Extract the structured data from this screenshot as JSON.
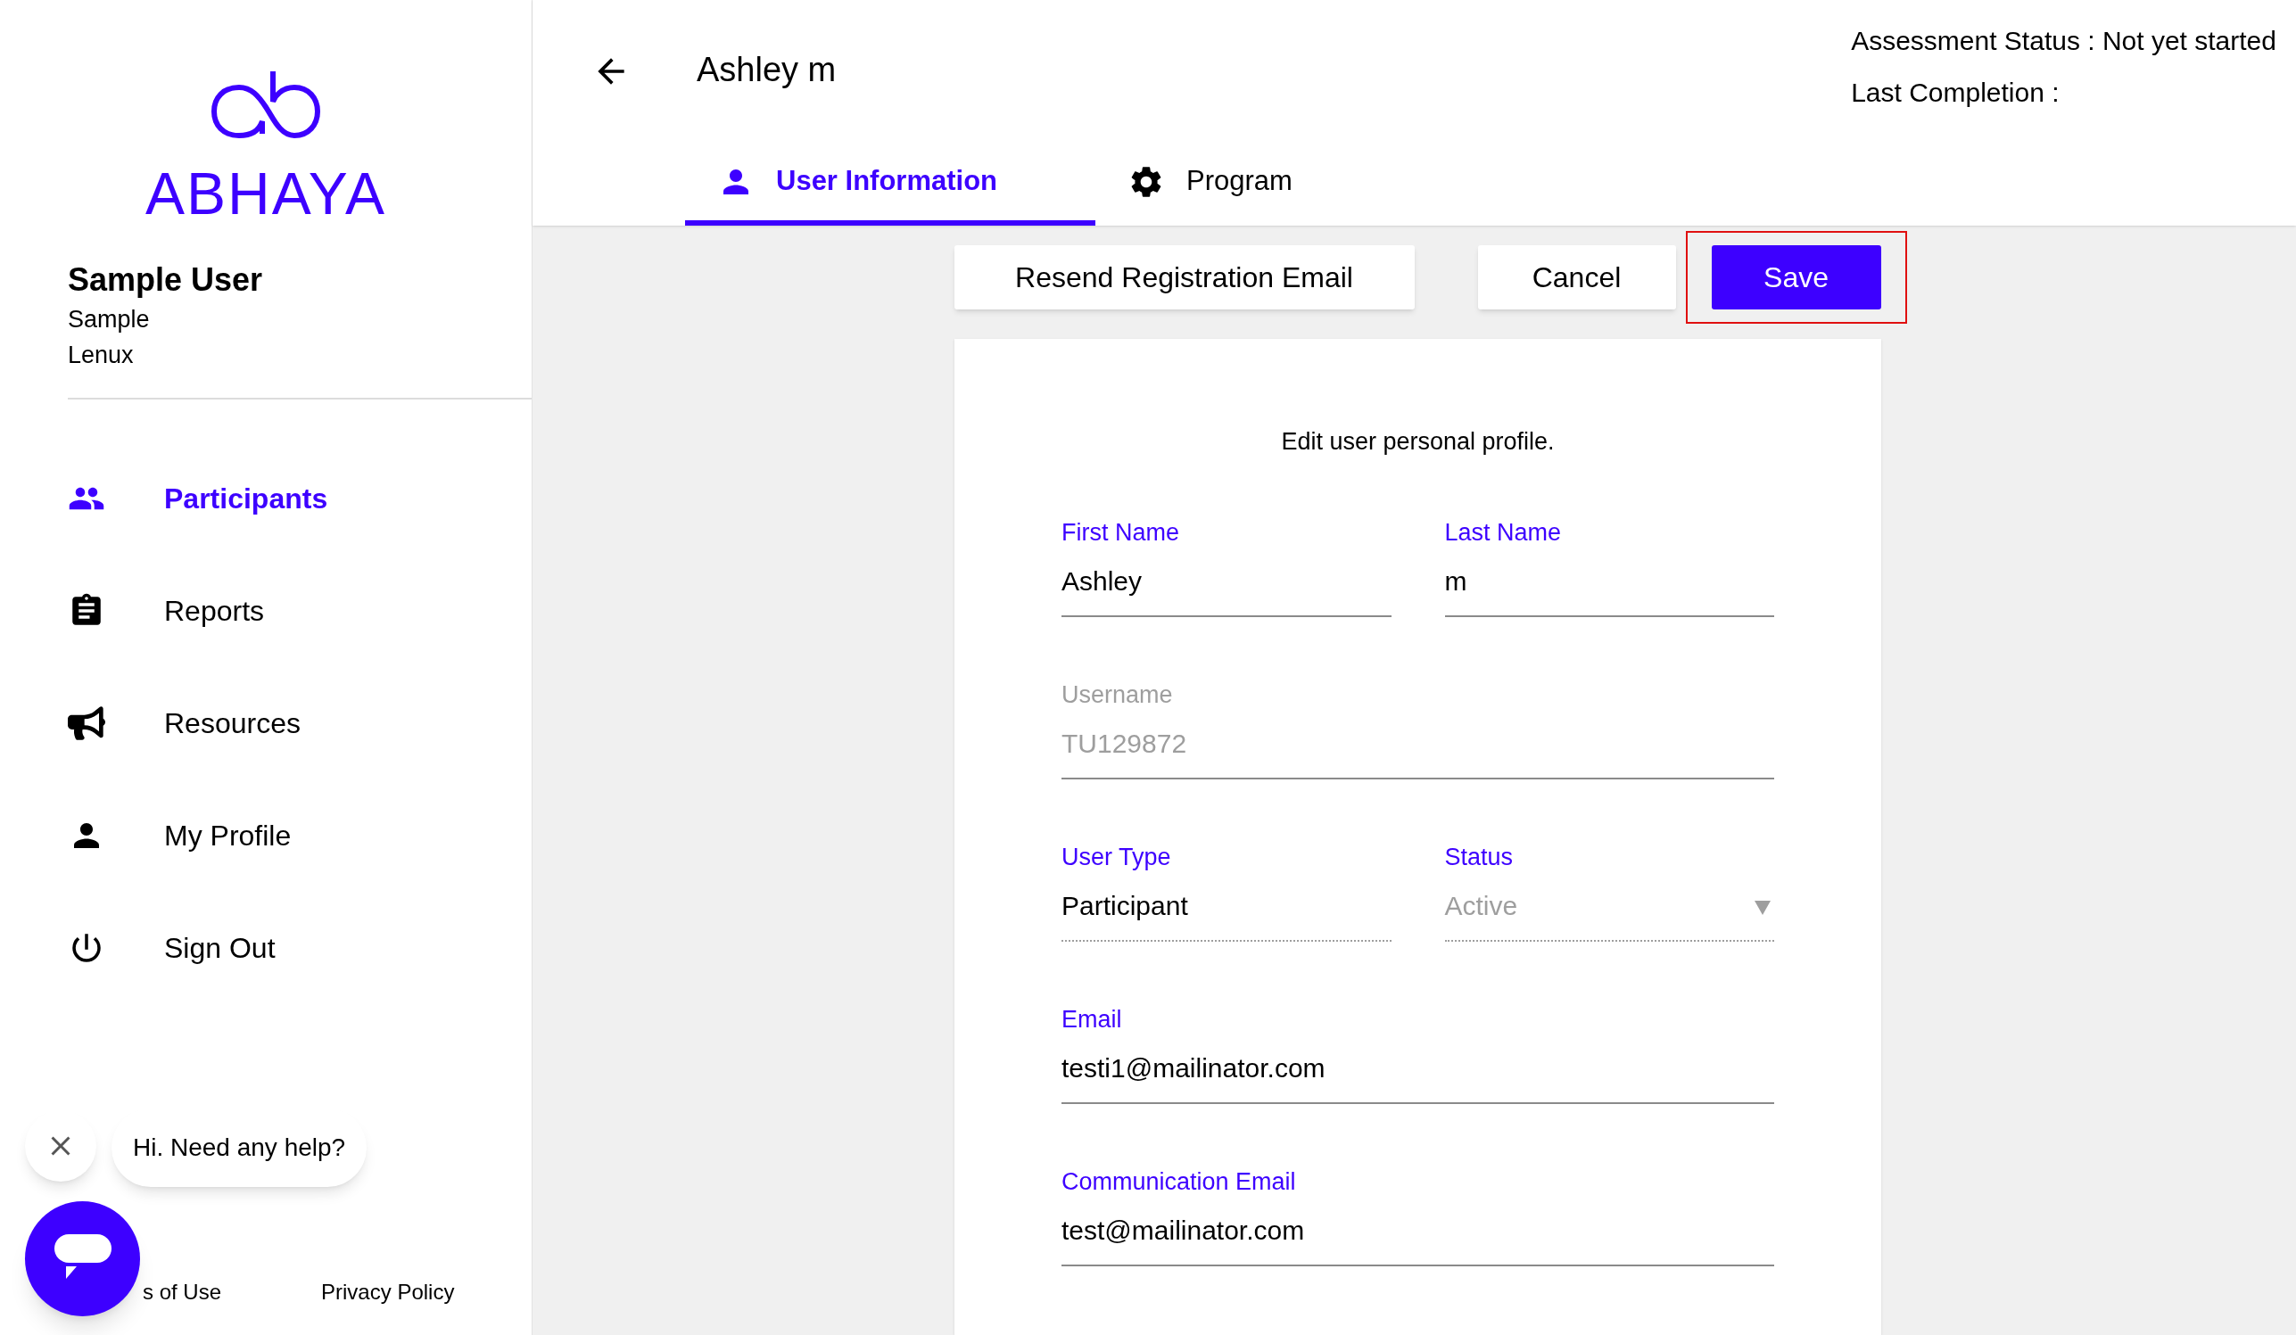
{
  "sidebar": {
    "logo_text": "ABHAYA",
    "user": {
      "name": "Sample User",
      "line_1": "Sample",
      "line_2": "Lenux"
    },
    "nav": [
      {
        "label": "Participants",
        "kind": "people",
        "selected": true
      },
      {
        "label": "Reports",
        "kind": "clipboard",
        "selected": false
      },
      {
        "label": "Resources",
        "kind": "megaphone",
        "selected": false
      },
      {
        "label": "My Profile",
        "kind": "person",
        "selected": false
      },
      {
        "label": "Sign Out",
        "kind": "power",
        "selected": false
      }
    ],
    "footer_links": [
      "s of Use",
      "Privacy Policy"
    ]
  },
  "chat": {
    "message": "Hi. Need any help?"
  },
  "header": {
    "title": "Ashley m",
    "assessment_status": "Assessment Status : Not yet started",
    "last_completion": "Last Completion :",
    "tabs": [
      {
        "label": "User Information",
        "kind": "person",
        "selected": true
      },
      {
        "label": "Program",
        "kind": "gear",
        "selected": false
      }
    ]
  },
  "actions": [
    {
      "label": "Resend Registration Email",
      "kind": "outline",
      "highlighted": false
    },
    {
      "label": "Cancel",
      "kind": "outline",
      "highlighted": false
    },
    {
      "label": "Save",
      "kind": "primary",
      "highlighted": true
    }
  ],
  "form": {
    "heading": "Edit user personal profile.",
    "rows": [
      [
        {
          "label": "First Name",
          "value": "Ashley",
          "kind": "text"
        },
        {
          "label": "Last Name",
          "value": "m",
          "kind": "text"
        }
      ],
      [
        {
          "label": "Username",
          "value": "TU129872",
          "kind": "disabled"
        }
      ],
      [
        {
          "label": "User Type",
          "value": "Participant",
          "kind": "readonly"
        },
        {
          "label": "Status",
          "value": "Active",
          "kind": "select"
        }
      ],
      [
        {
          "label": "Email",
          "value": "testi1@mailinator.com",
          "kind": "text"
        }
      ],
      [
        {
          "label": "Communication Email",
          "value": "test@mailinator.com",
          "kind": "text"
        }
      ]
    ]
  }
}
